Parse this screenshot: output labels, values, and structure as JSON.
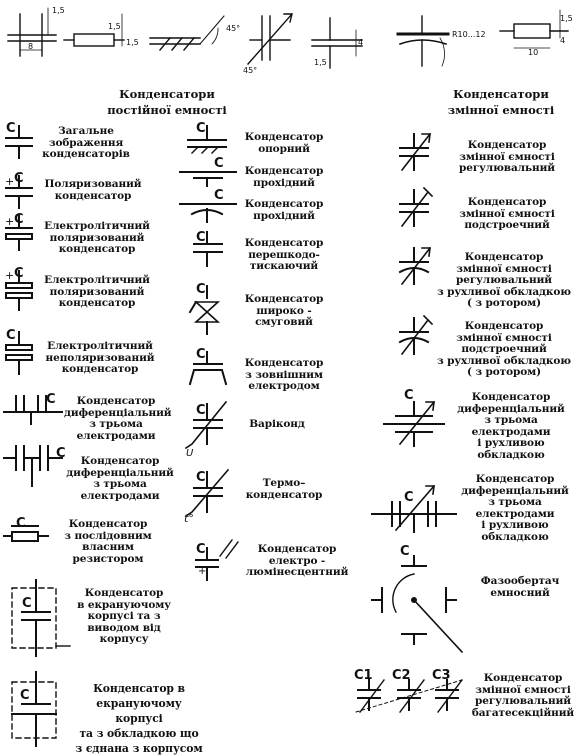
{
  "headers": {
    "fixed": "Конденсатори\nпостійної емності",
    "variable": "Конденсатори\nзмінної емності"
  },
  "dims": {
    "d15a": "1,5",
    "d8": "8",
    "d15b": "1,5",
    "d15c": "1,5",
    "ang45a": "45°",
    "ang45b": "45°",
    "d15d": "1,5",
    "d4a": "4",
    "r": "R10...12",
    "d15e": "1,5",
    "d4b": "4",
    "d10": "10"
  },
  "symbol_text": {
    "c": "C",
    "plus": "+",
    "u": "U",
    "t": "t°",
    "c1": "C1",
    "c2": "C2",
    "c3": "C3"
  },
  "labels": {
    "general": "Загальне\nзображення\nконденсаторів",
    "polarized": "Поляризований\nконденсатор",
    "electrolytic_polarized": "Електролітичний\nполяризований\nконденсатор",
    "electrolytic_polarized2": "Електролітичний\nполяризований\nконденсатор",
    "electrolytic_nonpolar": "Електролітичний\nнеполяризований\nконденсатор",
    "differential1": "Конденсатор\nдиференціальний\nз трьома\nелектродами",
    "differential2": "Конденсатор\nдиференціальний\nз трьома\nелектродами",
    "series_resistor": "Конденсатор\nз послідовним\nвласним\nрезистором",
    "shielded_lead": "Конденсатор\nв екрануючому\nкорпусі та з\nвиводом від\nкорпусу",
    "shielded_plate": "Конденсатор в\nекрануючому корпусі\nта з обкладкою що\nз єднана з корпусом",
    "reference": "Конденсатор\nопорний",
    "feedthrough1": "Конденсатор\nпрохідний",
    "feedthrough2": "Конденсатор\nпрохідний",
    "suppression": "Конденсатор\nперешкодо-\nтискаючий",
    "wideband": "Конденсатор\nшироко -\nсмуговий",
    "external_electrode": "Конденсатор\nз зовнішним\nелектродом",
    "varicond": "Варіконд",
    "thermo": "Термо–\nконденсатор",
    "electroluminescent": "Конденсатор\nелектро -\nлюмінесцентний",
    "var_adjustable": "Конденсатор\nзмінної ємності\nрегулювальний",
    "var_trimmer": "Конденсатор\nзмінної ємності\nподстроечний",
    "var_rotor_adj": "Конденсатор\nзмінної ємності\nрегулювальний\nз рухливої обкладкою\n( з ротором)",
    "var_rotor_trim": "Конденсатор\nзмінної ємності\nподстроечний\nз рухливої обкладкою\n( з ротором)",
    "var_diff1": "Конденсатор\nдиференціальний\nз трьома\nелектродами\nі рухливою\nобкладкою",
    "var_diff2": "Конденсатор\nдиференціальний\nз трьома\nелектродами\nі рухливою\nобкладкою",
    "phase_shifter": "Фазообертач\nемносний",
    "multisection": "Конденсатор\nзмінної ємності\nрегулювальний\nбагатесекційний"
  }
}
